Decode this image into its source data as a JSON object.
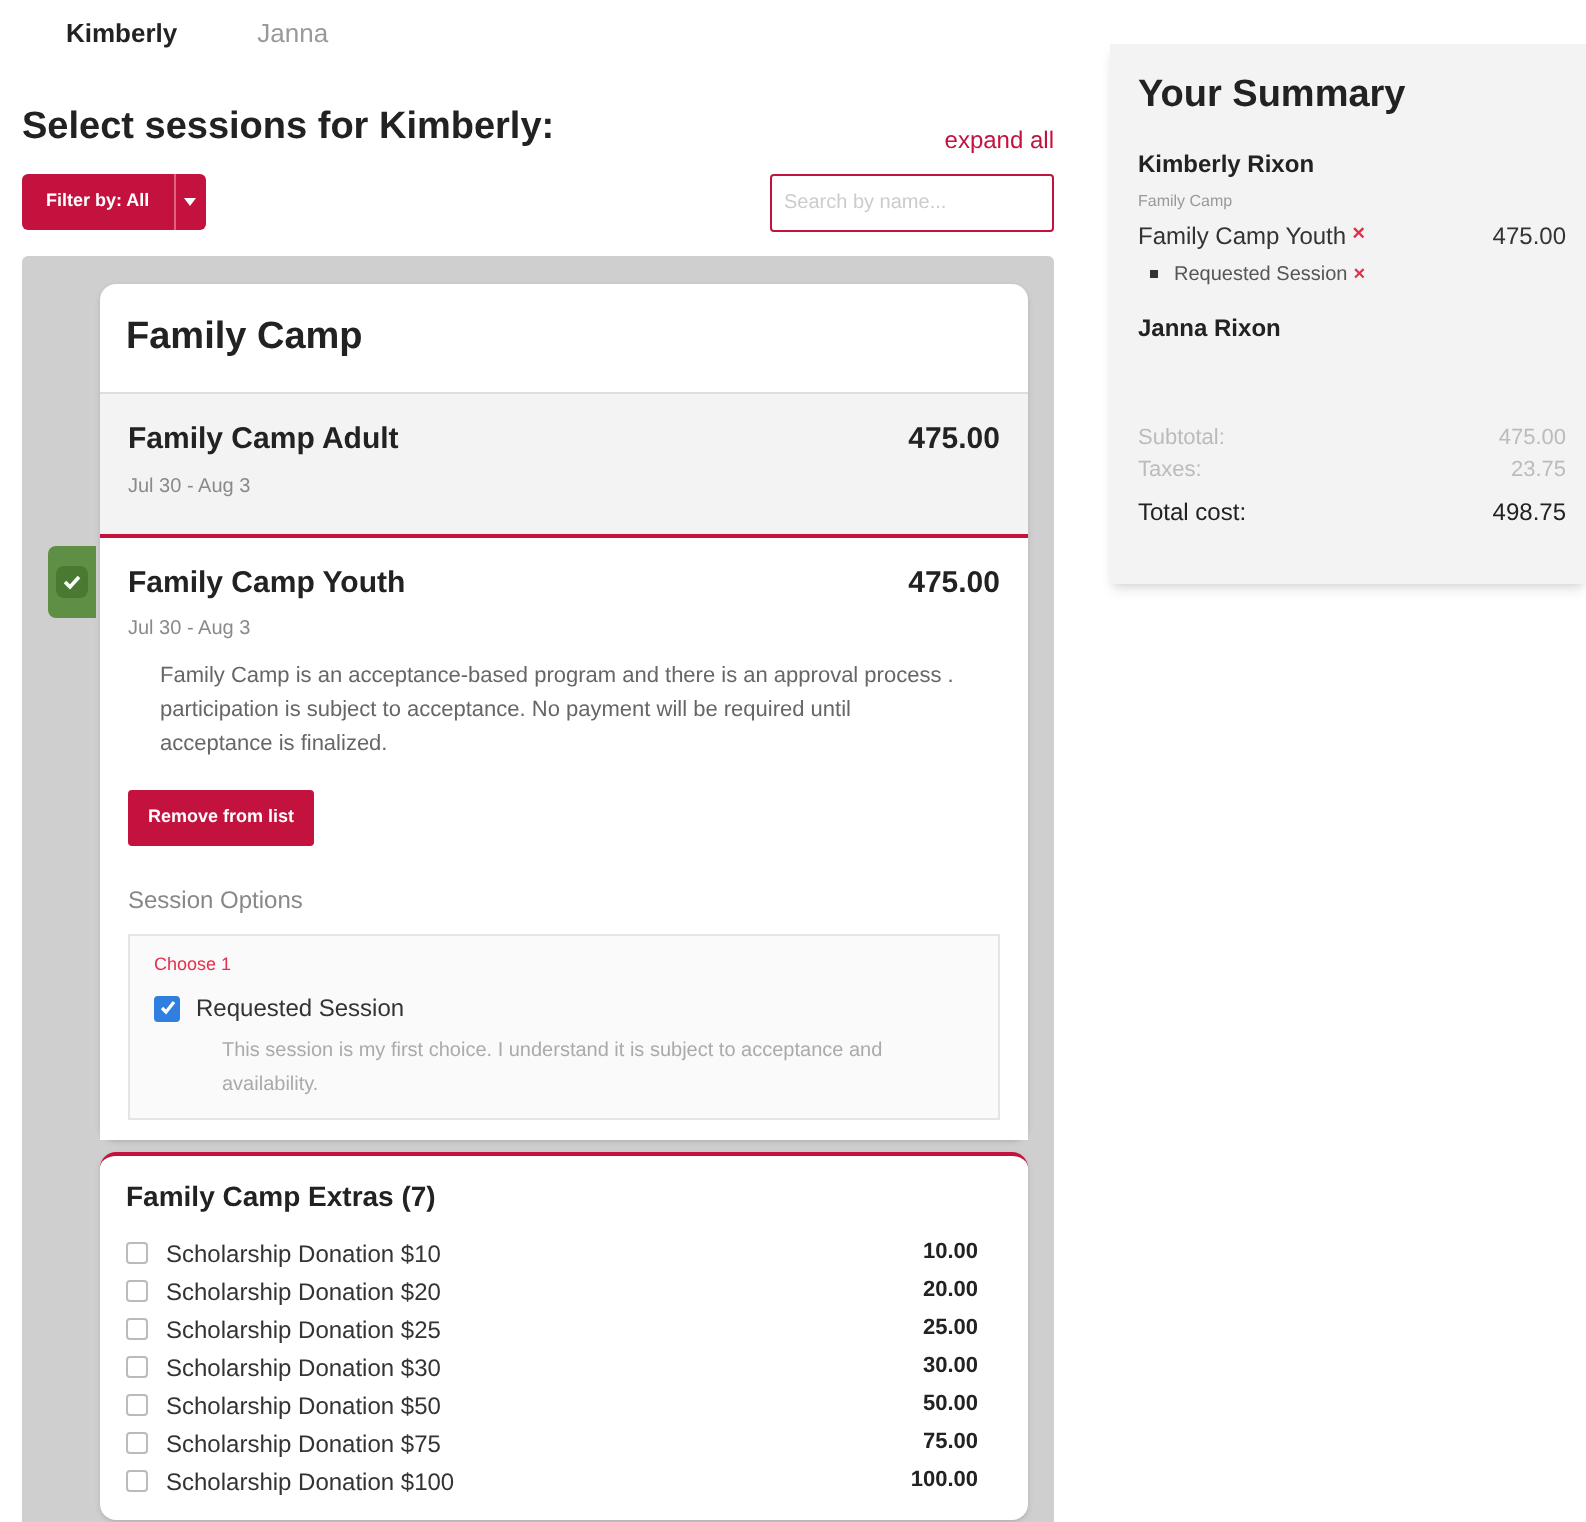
{
  "tabs": [
    {
      "label": "Kimberly",
      "selected": true
    },
    {
      "label": "Janna",
      "selected": false
    }
  ],
  "heading": "Select sessions for Kimberly:",
  "expand_link": "expand all",
  "filter_button": "Filter by: All",
  "search": {
    "placeholder": "Search by name..."
  },
  "camp": {
    "title": "Family Camp",
    "sessions": [
      {
        "name": "Family Camp Adult",
        "price": "475.00",
        "dates": "Jul 30 - Aug 3",
        "selected": false
      },
      {
        "name": "Family Camp Youth",
        "price": "475.00",
        "dates": "Jul 30 - Aug 3",
        "selected": true,
        "description": "Family Camp is an acceptance-based program and there is an approval process . participation is subject to acceptance. No payment will be required until acceptance is finalized.",
        "remove_button": "Remove from list",
        "options_title": "Session Options",
        "choose_label": "Choose 1",
        "options": [
          {
            "label": "Requested Session",
            "checked": true,
            "note": "This session is my first choice. I understand it is subject to acceptance and availability."
          }
        ]
      }
    ],
    "extras": {
      "title": "Family Camp Extras (7)",
      "items": [
        {
          "label": "Scholarship Donation $10",
          "price": "10.00",
          "checked": false
        },
        {
          "label": "Scholarship Donation $20",
          "price": "20.00",
          "checked": false
        },
        {
          "label": "Scholarship Donation $25",
          "price": "25.00",
          "checked": false
        },
        {
          "label": "Scholarship Donation $30",
          "price": "30.00",
          "checked": false
        },
        {
          "label": "Scholarship Donation $50",
          "price": "50.00",
          "checked": false
        },
        {
          "label": "Scholarship Donation $75",
          "price": "75.00",
          "checked": false
        },
        {
          "label": "Scholarship Donation $100",
          "price": "100.00",
          "checked": false
        }
      ]
    }
  },
  "summary": {
    "title": "Your Summary",
    "people": [
      {
        "name": "Kimberly Rixon",
        "program": "Family Camp",
        "items": [
          {
            "name": "Family Camp Youth",
            "price": "475.00",
            "remove": "×",
            "options": [
              {
                "name": "Requested Session",
                "remove": "×"
              }
            ]
          }
        ]
      },
      {
        "name": "Janna Rixon"
      }
    ],
    "totals": [
      {
        "label": "Subtotal:",
        "value": "475.00",
        "kind": "minor"
      },
      {
        "label": "Taxes:",
        "value": "23.75",
        "kind": "minor"
      },
      {
        "label": "Total cost:",
        "value": "498.75",
        "kind": "total"
      }
    ]
  }
}
